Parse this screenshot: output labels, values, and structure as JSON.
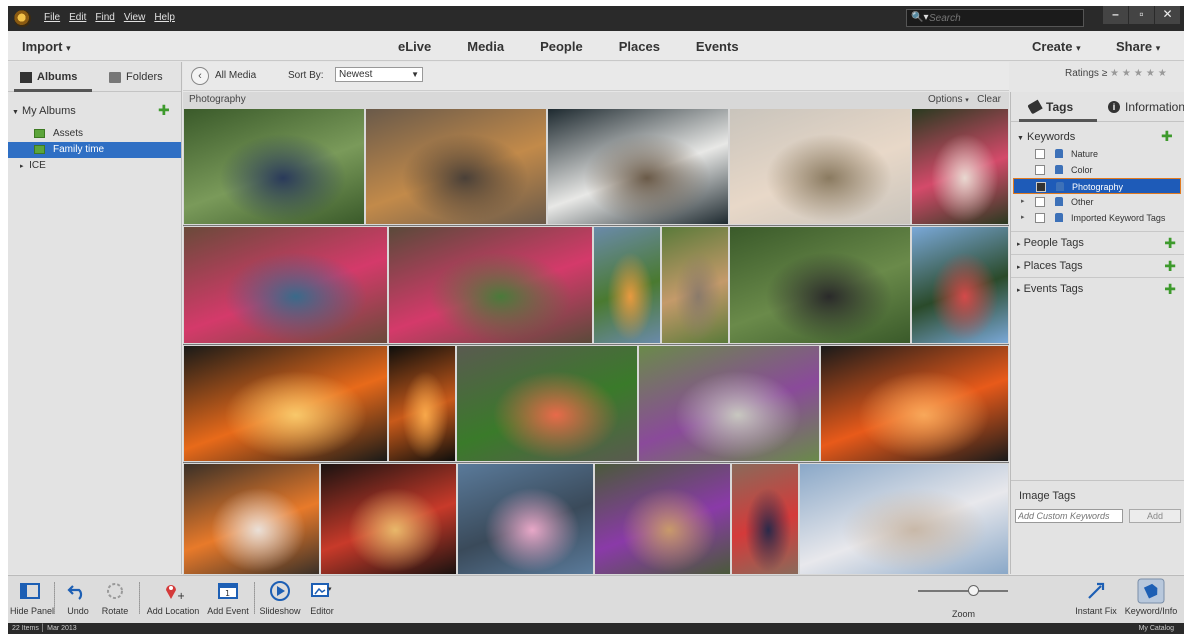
{
  "titlebar": {
    "menu": [
      "File",
      "Edit",
      "Find",
      "View",
      "Help"
    ],
    "search_placeholder": "Search"
  },
  "topnav": {
    "import": "Import",
    "tabs": [
      "eLive",
      "Media",
      "People",
      "Places",
      "Events"
    ],
    "create": "Create",
    "share": "Share"
  },
  "leftpanel": {
    "tabs": {
      "albums": "Albums",
      "folders": "Folders"
    },
    "my_albums": "My Albums",
    "albums": [
      {
        "label": "Assets",
        "selected": false
      },
      {
        "label": "Family time",
        "selected": true
      }
    ],
    "folder_item": "ICE"
  },
  "gridbar": {
    "back_label": "All Media",
    "sort_by_label": "Sort By:",
    "sort_value": "Newest",
    "ratings_label": "Ratings",
    "ratings_op": "≥",
    "stars": "★★★★★"
  },
  "grid": {
    "header": "Photography",
    "options": "Options",
    "clear": "Clear",
    "photos": [
      {
        "subject": "two women outdoors",
        "colors": [
          "#3a5a2a",
          "#7a9a5a",
          "#2a3a5a"
        ]
      },
      {
        "subject": "dog sleeping",
        "colors": [
          "#6a5a4a",
          "#c28a4a",
          "#4a4038"
        ]
      },
      {
        "subject": "front door girl",
        "colors": [
          "#1e2a30",
          "#e8e8e6",
          "#6a5a48"
        ]
      },
      {
        "subject": "kids on bed",
        "colors": [
          "#c9c4bc",
          "#e8d8c8",
          "#8a7a60"
        ]
      },
      {
        "subject": "birthday cake girl",
        "colors": [
          "#2a3a20",
          "#d44a6a",
          "#e8d8d0"
        ]
      },
      {
        "subject": "birthday group 1",
        "colors": [
          "#6a4a3a",
          "#d43a6a",
          "#3a6a8a"
        ]
      },
      {
        "subject": "birthday group 2",
        "colors": [
          "#5a4a3a",
          "#d43a6a",
          "#4a7a3a"
        ]
      },
      {
        "subject": "hula hoop girl",
        "colors": [
          "#6a8aaa",
          "#4a7a30",
          "#e89a40"
        ]
      },
      {
        "subject": "dog on deck",
        "colors": [
          "#5a7a3a",
          "#c49a6a",
          "#8a7a6a"
        ]
      },
      {
        "subject": "family in yard",
        "colors": [
          "#3a5a2a",
          "#6a8a4a",
          "#2a2a2a"
        ]
      },
      {
        "subject": "girl jumping",
        "colors": [
          "#7aa8d8",
          "#2a4a2a",
          "#d44a4a"
        ]
      },
      {
        "subject": "campfire 1",
        "colors": [
          "#1a1a18",
          "#e86a1a",
          "#f8c86a"
        ]
      },
      {
        "subject": "campfire night",
        "colors": [
          "#0e0e0c",
          "#c85a1a",
          "#f8a84a"
        ]
      },
      {
        "subject": "kids playing legos",
        "colors": [
          "#5a5a50",
          "#3a7a2a",
          "#e86a4a"
        ]
      },
      {
        "subject": "kids jumping",
        "colors": [
          "#6a8a4a",
          "#8a4a9a",
          "#c8c8c0"
        ]
      },
      {
        "subject": "fire pit embers",
        "colors": [
          "#1a1a1a",
          "#e85a1a",
          "#f8a85a"
        ]
      },
      {
        "subject": "marshmallows fire",
        "colors": [
          "#3a3028",
          "#e87a2a",
          "#eae0d8"
        ]
      },
      {
        "subject": "flag sparklers",
        "colors": [
          "#1a1210",
          "#c83a2a",
          "#e8b86a"
        ]
      },
      {
        "subject": "girl on porch",
        "colors": [
          "#5a7a9a",
          "#3a4a5a",
          "#e8a8c8"
        ]
      },
      {
        "subject": "girl on swing",
        "colors": [
          "#4a5a3a",
          "#8a3aa8",
          "#c89a6a"
        ]
      },
      {
        "subject": "two women hugging",
        "colors": [
          "#8a6a5a",
          "#d43a3a",
          "#2a2a4a"
        ]
      },
      {
        "subject": "beach running",
        "colors": [
          "#8aa8c8",
          "#e8e8ec",
          "#c8b8a8"
        ]
      }
    ]
  },
  "rightpanel": {
    "tabs": {
      "tags": "Tags",
      "information": "Information"
    },
    "keywords_label": "Keywords",
    "keywords": [
      {
        "label": "Nature",
        "selected": false,
        "expandable": false
      },
      {
        "label": "Color",
        "selected": false,
        "expandable": false
      },
      {
        "label": "Photography",
        "selected": true,
        "expandable": false
      },
      {
        "label": "Other",
        "selected": false,
        "expandable": true
      },
      {
        "label": "Imported Keyword Tags",
        "selected": false,
        "expandable": true
      }
    ],
    "sections": [
      "People Tags",
      "Places Tags",
      "Events Tags"
    ],
    "image_tags": {
      "title": "Image Tags",
      "placeholder": "Add Custom Keywords",
      "add": "Add"
    }
  },
  "bottombar": {
    "tools": [
      {
        "label": "Hide Panel",
        "icon": "hide-panel-icon"
      },
      {
        "label": "Undo",
        "icon": "undo-icon"
      },
      {
        "label": "Rotate",
        "icon": "rotate-icon"
      },
      {
        "label": "Add Location",
        "icon": "map-pin-icon"
      },
      {
        "label": "Add Event",
        "icon": "calendar-icon"
      },
      {
        "label": "Slideshow",
        "icon": "play-icon"
      },
      {
        "label": "Editor",
        "icon": "editor-icon"
      }
    ],
    "zoom_label": "Zoom",
    "instant_fix": "Instant Fix",
    "keyword_info": "Keyword/Info"
  },
  "status": {
    "left": "22 Items │ Mar 2013",
    "right": "My Catalog"
  }
}
